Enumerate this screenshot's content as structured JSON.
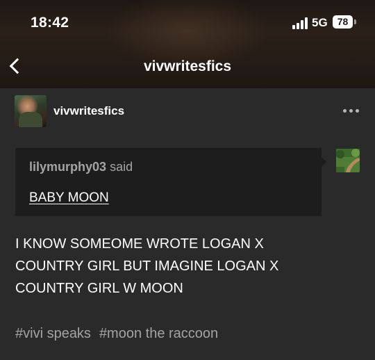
{
  "status_bar": {
    "time": "18:42",
    "network": "5G",
    "battery": "78"
  },
  "header": {
    "title": "vivwritesfics",
    "back_icon": "chevron-left-icon"
  },
  "post": {
    "author": "vivwritesfics",
    "more_icon": "ellipsis-icon",
    "reblog": {
      "username": "lilymurphy03",
      "said_label": "said",
      "text": "BABY MOON"
    },
    "body_lines": [
      "I KNOW SOMEOME WROTE LOGAN X",
      "COUNTRY GIRL BUT IMAGINE LOGAN X",
      "COUNTRY GIRL W MOON"
    ],
    "tags": [
      "#vivi speaks",
      "#moon the raccoon"
    ]
  },
  "colors": {
    "background": "#2a2a2b",
    "card": "#1d1d1e",
    "muted_text": "#a4a4a4"
  }
}
